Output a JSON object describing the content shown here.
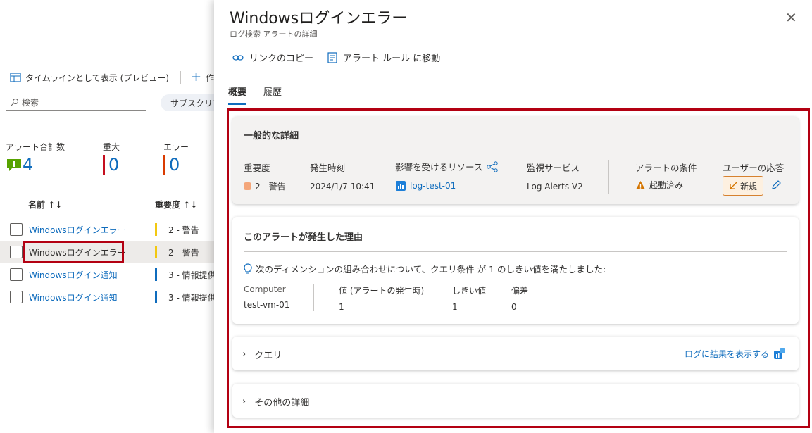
{
  "left": {
    "toolbar": {
      "timeline": "タイムラインとして表示 (プレビュー)",
      "create": "作成"
    },
    "search_placeholder": "検索",
    "filter_pill": "サブスクリプション",
    "stats": {
      "total_label": "アラート合計数",
      "total": "4",
      "critical_label": "重大",
      "critical": "0",
      "error_label": "エラー",
      "error": "0"
    },
    "headers": {
      "name": "名前 ↑↓",
      "severity": "重要度 ↑↓"
    },
    "rows": [
      {
        "name": "Windowsログインエラー",
        "severity": "2 - 警告",
        "color": "#f2c811"
      },
      {
        "name": "Windowsログインエラー",
        "severity": "2 - 警告",
        "color": "#f2c811"
      },
      {
        "name": "Windowsログイン通知",
        "severity": "3 - 情報提供",
        "color": "#0f6cbd"
      },
      {
        "name": "Windowsログイン通知",
        "severity": "3 - 情報提供",
        "color": "#0f6cbd"
      }
    ]
  },
  "panel": {
    "title": "Windowsログインエラー",
    "subtitle": "ログ検索 アラートの詳細",
    "commands": {
      "copy_link": "リンクのコピー",
      "goto_rule": "アラート ルール に移動"
    },
    "tabs": {
      "overview": "概要",
      "history": "履歴"
    },
    "general": {
      "title": "一般的な詳細",
      "severity_label": "重要度",
      "severity_value": "2 - 警告",
      "time_label": "発生時刻",
      "time_value": "2024/1/7 10:41",
      "resource_label": "影響を受けるリソース",
      "resource_value": "log-test-01",
      "service_label": "監視サービス",
      "service_value": "Log Alerts V2",
      "condition_label": "アラートの条件",
      "condition_value": "起動済み",
      "response_label": "ユーザーの応答",
      "response_value": "新規"
    },
    "reason": {
      "title": "このアラートが発生した理由",
      "message": "次のディメンションの組み合わせについて、クエリ条件 が 1 のしきい値を満たしました:",
      "dim_label": "Computer",
      "dim_value": "test-vm-01",
      "col_value": "値 (アラートの発生時)",
      "col_threshold": "しきい値",
      "col_deviation": "偏差",
      "value": "1",
      "threshold": "1",
      "deviation": "0"
    },
    "query": {
      "label": "クエリ",
      "link": "ログに結果を表示する"
    },
    "other": {
      "label": "その他の詳細"
    }
  },
  "colors": {
    "accent": "#0f6cbd",
    "highlight": "#b30012",
    "warning": "#f4a67a"
  }
}
